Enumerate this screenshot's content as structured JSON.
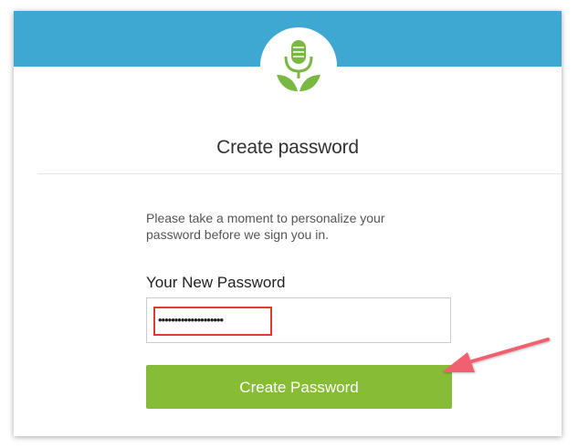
{
  "page": {
    "title": "Create password",
    "intro": "Please take a moment to personalize your password before we sign you in.",
    "password_label": "Your New Password",
    "password_value": "••••••••••••••••••••",
    "button_label": "Create Password"
  },
  "icons": {
    "logo": "microphone-leaves-logo-icon",
    "arrow": "annotation-arrow-icon"
  },
  "colors": {
    "banner": "#3ea8d2",
    "button": "#86bc36",
    "logo_green": "#78b843",
    "highlight": "#e23a32",
    "arrow": "#f0606e"
  }
}
